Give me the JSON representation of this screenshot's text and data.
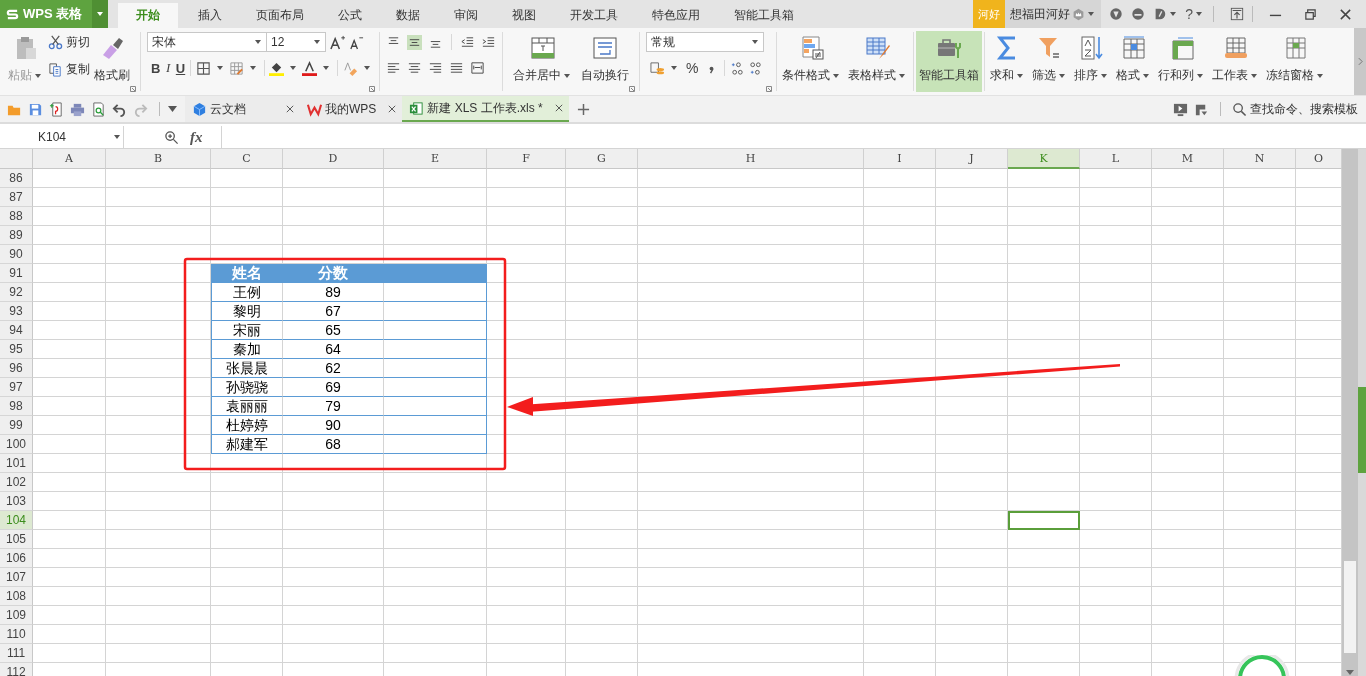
{
  "app": {
    "name": "WPS 表格"
  },
  "menu_tabs": [
    {
      "label": "开始",
      "selected": true
    },
    {
      "label": "插入",
      "selected": false
    },
    {
      "label": "页面布局",
      "selected": false
    },
    {
      "label": "公式",
      "selected": false
    },
    {
      "label": "数据",
      "selected": false
    },
    {
      "label": "审阅",
      "selected": false
    },
    {
      "label": "视图",
      "selected": false
    },
    {
      "label": "开发工具",
      "selected": false
    },
    {
      "label": "特色应用",
      "selected": false
    },
    {
      "label": "智能工具箱",
      "selected": false
    }
  ],
  "account": {
    "badge": "河好",
    "user": "想福田河好",
    "help": "?"
  },
  "ribbon": {
    "clipboard": {
      "paste": "粘贴",
      "cut": "剪切",
      "copy": "复制",
      "painter": "格式刷"
    },
    "font": {
      "name": "宋体",
      "size": "12",
      "styles": [
        "B",
        "I",
        "U"
      ]
    },
    "alignment": {
      "merge": "合并居中",
      "wrap": "自动换行"
    },
    "number": {
      "format": "常规",
      "percent": "%"
    },
    "tools": [
      {
        "label": "条件格式",
        "has_menu": true,
        "active": false
      },
      {
        "label": "表格样式",
        "has_menu": true,
        "active": false
      },
      {
        "label": "智能工具箱",
        "has_menu": false,
        "active": true
      },
      {
        "label": "求和",
        "has_menu": true,
        "active": false
      },
      {
        "label": "筛选",
        "has_menu": true,
        "active": false
      },
      {
        "label": "排序",
        "has_menu": true,
        "active": false
      },
      {
        "label": "格式",
        "has_menu": true,
        "active": false
      },
      {
        "label": "行和列",
        "has_menu": true,
        "active": false
      },
      {
        "label": "工作表",
        "has_menu": true,
        "active": false
      },
      {
        "label": "冻结窗格",
        "has_menu": true,
        "active": false
      }
    ]
  },
  "doc_tabs": [
    {
      "label": "云文档",
      "selected": false
    },
    {
      "label": "我的WPS",
      "selected": false
    },
    {
      "label": "新建 XLS 工作表.xls *",
      "selected": true
    }
  ],
  "search": {
    "placeholder": "查找命令、搜索模板"
  },
  "formula_bar": {
    "cell_ref": "K104",
    "fx": "fx"
  },
  "sheet": {
    "columns": [
      {
        "label": "A",
        "selected": false
      },
      {
        "label": "B",
        "selected": false
      },
      {
        "label": "C",
        "selected": false
      },
      {
        "label": "D",
        "selected": false
      },
      {
        "label": "E",
        "selected": false
      },
      {
        "label": "F",
        "selected": false
      },
      {
        "label": "G",
        "selected": false
      },
      {
        "label": "H",
        "selected": false
      },
      {
        "label": "I",
        "selected": false
      },
      {
        "label": "J",
        "selected": false
      },
      {
        "label": "K",
        "selected": true
      },
      {
        "label": "L",
        "selected": false
      },
      {
        "label": "M",
        "selected": false
      },
      {
        "label": "N",
        "selected": false
      },
      {
        "label": "O",
        "selected": false
      }
    ],
    "rows": [
      {
        "label": "86",
        "selected": false
      },
      {
        "label": "87",
        "selected": false
      },
      {
        "label": "88",
        "selected": false
      },
      {
        "label": "89",
        "selected": false
      },
      {
        "label": "90",
        "selected": false
      },
      {
        "label": "91",
        "selected": false
      },
      {
        "label": "92",
        "selected": false
      },
      {
        "label": "93",
        "selected": false
      },
      {
        "label": "94",
        "selected": false
      },
      {
        "label": "95",
        "selected": false
      },
      {
        "label": "96",
        "selected": false
      },
      {
        "label": "97",
        "selected": false
      },
      {
        "label": "98",
        "selected": false
      },
      {
        "label": "99",
        "selected": false
      },
      {
        "label": "100",
        "selected": false
      },
      {
        "label": "101",
        "selected": false
      },
      {
        "label": "102",
        "selected": false
      },
      {
        "label": "103",
        "selected": false
      },
      {
        "label": "104",
        "selected": true
      },
      {
        "label": "105",
        "selected": false
      },
      {
        "label": "106",
        "selected": false
      },
      {
        "label": "107",
        "selected": false
      },
      {
        "label": "108",
        "selected": false
      },
      {
        "label": "109",
        "selected": false
      },
      {
        "label": "110",
        "selected": false
      },
      {
        "label": "111",
        "selected": false
      },
      {
        "label": "112",
        "selected": false
      }
    ]
  },
  "data_table": {
    "columns": [
      "姓名",
      "分数"
    ],
    "rows": [
      [
        "王例",
        "89"
      ],
      [
        "黎明",
        "67"
      ],
      [
        "宋丽",
        "65"
      ],
      [
        "秦加",
        "64"
      ],
      [
        "张晨晨",
        "62"
      ],
      [
        "孙骁骁",
        "69"
      ],
      [
        "袁丽丽",
        "79"
      ],
      [
        "杜婷婷",
        "90"
      ],
      [
        "郝建军",
        "68"
      ]
    ]
  }
}
